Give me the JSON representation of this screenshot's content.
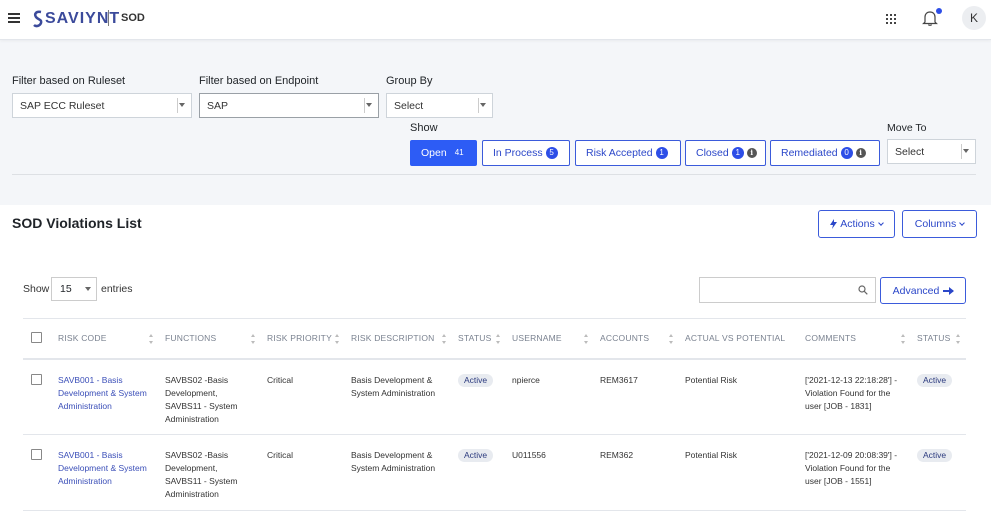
{
  "header": {
    "brand": "SAVIYNT",
    "app_title": "SOD",
    "avatar_initial": "K"
  },
  "filters": {
    "ruleset_label": "Filter based on Ruleset",
    "ruleset_value": "SAP ECC Ruleset",
    "endpoint_label": "Filter based on Endpoint",
    "endpoint_value": "SAP",
    "groupby_label": "Group By",
    "groupby_value": "Select",
    "show_label": "Show",
    "moveto_label": "Move To",
    "moveto_value": "Select"
  },
  "status_tabs": [
    {
      "label": "Open",
      "count": "41"
    },
    {
      "label": "In Process",
      "count": "5"
    },
    {
      "label": "Risk Accepted",
      "count": "1"
    },
    {
      "label": "Closed",
      "count": "1"
    },
    {
      "label": "Remediated",
      "count": "0"
    }
  ],
  "list": {
    "title": "SOD Violations List",
    "actions_label": "Actions",
    "columns_label": "Columns",
    "show_label": "Show",
    "entries_value": "15",
    "entries_label": "entries",
    "advanced_label": "Advanced"
  },
  "table": {
    "headers": [
      "RISK CODE",
      "FUNCTIONS",
      "RISK PRIORITY",
      "RISK DESCRIPTION",
      "STATUS",
      "USERNAME",
      "ACCOUNTS",
      "ACTUAL VS POTENTIAL",
      "COMMENTS",
      "STATUS"
    ],
    "rows": [
      {
        "risk_code": "SAVB001 - Basis Development & System Administration",
        "functions": "SAVBS02 -Basis Development, SAVBS11 - System Administration",
        "priority": "Critical",
        "description": "Basis Development & System Administration",
        "status": "Active",
        "username": "npierce",
        "account": "REM3617",
        "actual_vs_potential": "Potential Risk",
        "comments": "['2021-12-13 22:18:28'] - Violation Found for the user [JOB - 1831]",
        "status2": "Active"
      },
      {
        "risk_code": "SAVB001 - Basis Development & System Administration",
        "functions": "SAVBS02 -Basis Development, SAVBS11 - System Administration",
        "priority": "Critical",
        "description": "Basis Development & System Administration",
        "status": "Active",
        "username": "U011556",
        "account": "REM362",
        "actual_vs_potential": "Potential Risk",
        "comments": "['2021-12-09 20:08:39'] - Violation Found for the user [JOB - 1551]",
        "status2": "Active"
      }
    ]
  }
}
